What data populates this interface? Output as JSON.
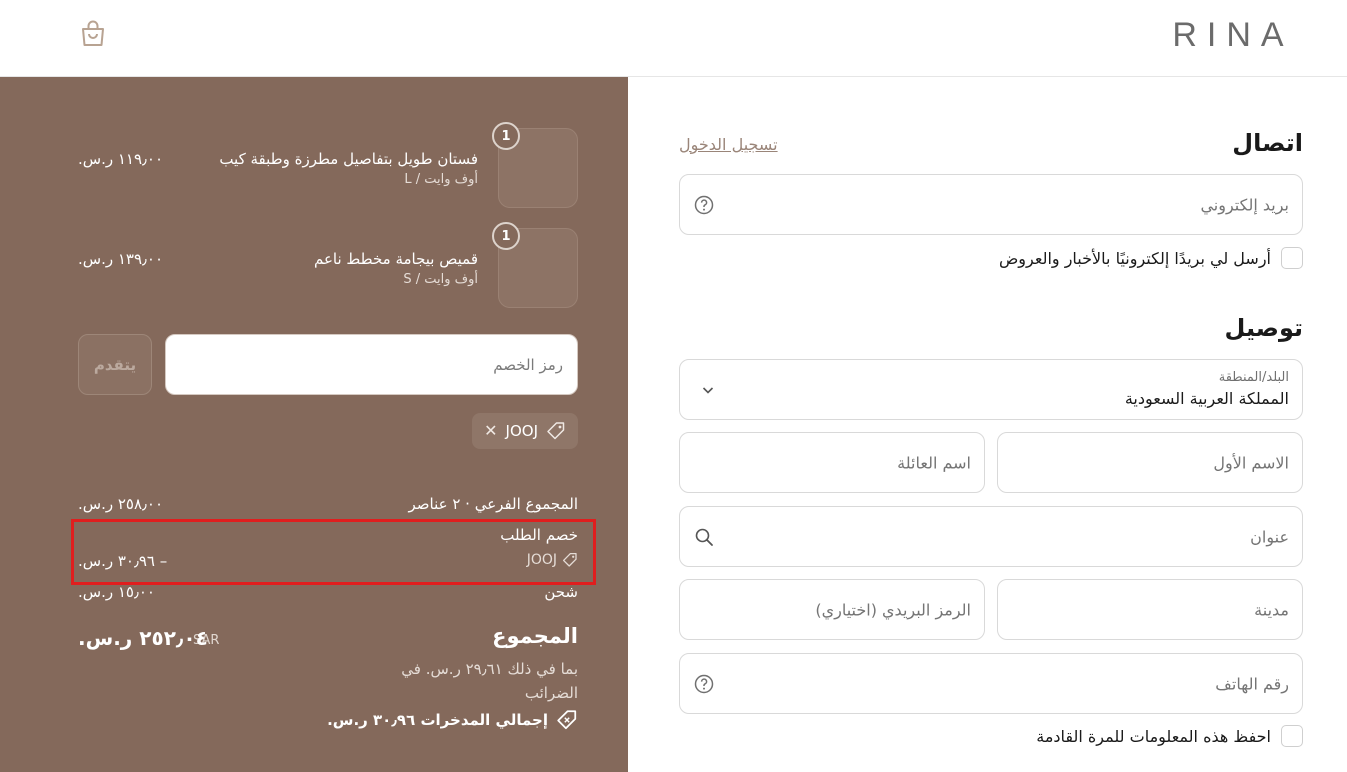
{
  "header": {
    "logo_text": "RINA",
    "cart_icon": "shopping-bag-icon"
  },
  "order_summary": {
    "items": [
      {
        "quantity": "1",
        "title": "فستان طويل بتفاصيل مطرزة وطبقة كيب",
        "variant": "أوف وايت / L",
        "price": "١١٩٫٠٠ ر.س."
      },
      {
        "quantity": "1",
        "title": "قميص بيجامة مخطط ناعم",
        "variant": "أوف وايت / S",
        "price": "١٣٩٫٠٠ ر.س."
      }
    ],
    "discount_placeholder": "رمز الخصم",
    "apply_label": "يتقدم",
    "applied_code": "JOOJ",
    "subtotal_label": "المجموع الفرعي · ٢ عناصر",
    "subtotal_value": "٢٥٨٫٠٠ ر.س.",
    "order_discount_label": "خصم الطلب",
    "order_discount_code": "JOOJ",
    "order_discount_value": "– ٣٠٫٩٦ ر.س.",
    "shipping_label": "شحن",
    "shipping_value": "١٥٫٠٠ ر.س.",
    "total_label": "المجموع",
    "total_currency": "SAR",
    "total_value": "٢٥٢٫٠٤ ر.س.",
    "tax_note": "بما في ذلك ٢٩٫٦١ ر.س. في الضرائب",
    "savings_text": "إجمالي المدخرات ٣٠٫٩٦ ر.س."
  },
  "contact": {
    "title": "اتصال",
    "login_link": "تسجيل الدخول",
    "email_placeholder": "بريد إلكتروني",
    "newsletter_label": "أرسل لي بريدًا إلكترونيًا بالأخبار والعروض"
  },
  "delivery": {
    "title": "توصيل",
    "country_label": "البلد/المنطقة",
    "country_value": "المملكة العربية السعودية",
    "first_name_placeholder": "الاسم الأول",
    "last_name_placeholder": "اسم العائلة",
    "address_placeholder": "عنوان",
    "city_placeholder": "مدينة",
    "postal_placeholder": "الرمز البريدي (اختياري)",
    "phone_placeholder": "رقم الهاتف",
    "save_info_label": "احفظ هذه المعلومات للمرة القادمة"
  },
  "colors": {
    "sidebar_bg": "#84695b",
    "highlight": "#e01e1e",
    "link": "#9a8579"
  }
}
